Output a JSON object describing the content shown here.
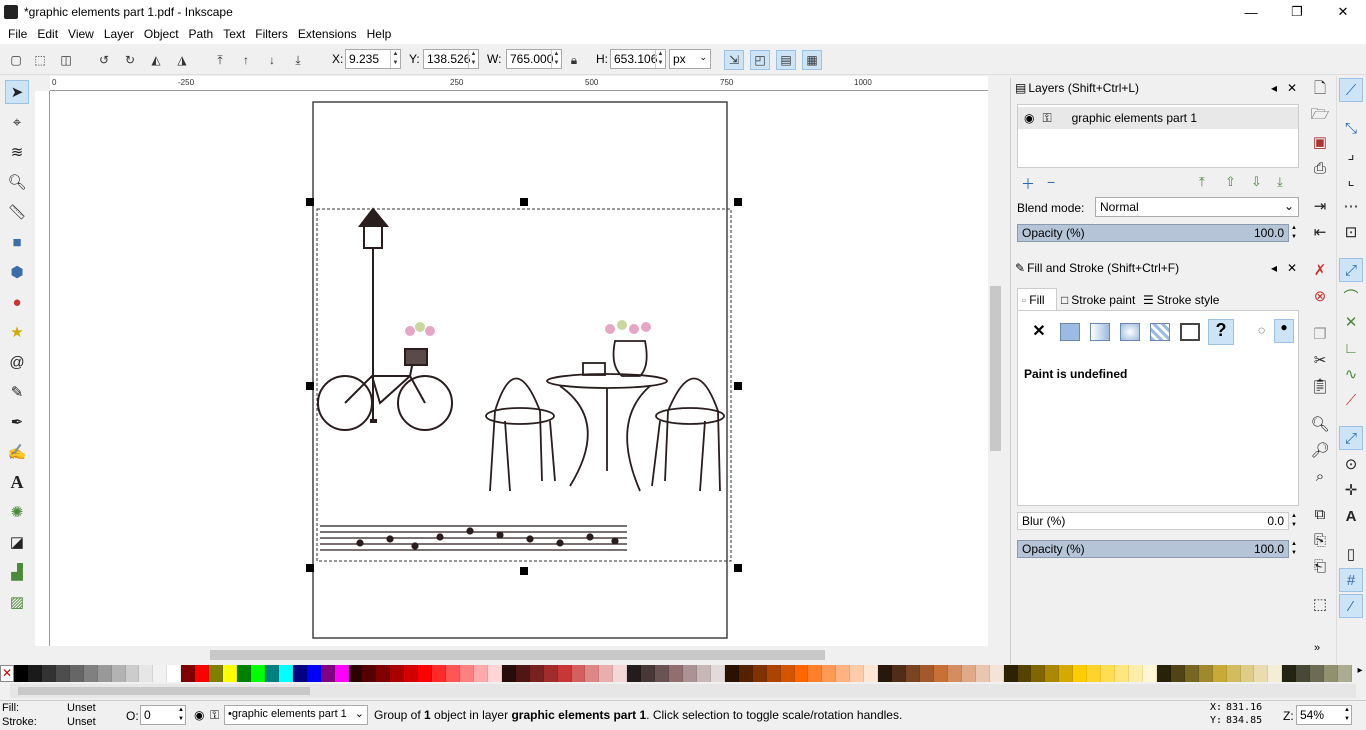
{
  "window": {
    "title": "*graphic elements part 1.pdf - Inkscape",
    "minimize": "—",
    "maximize": "❐",
    "close": "✕"
  },
  "menu": [
    "File",
    "Edit",
    "View",
    "Layer",
    "Object",
    "Path",
    "Text",
    "Filters",
    "Extensions",
    "Help"
  ],
  "toolcontrols": {
    "x_label": "X:",
    "x_value": "9.235",
    "y_label": "Y:",
    "y_value": "138.526",
    "w_label": "W:",
    "w_value": "765.000",
    "h_label": "H:",
    "h_value": "653.106",
    "unit": "px"
  },
  "ruler": {
    "labels": [
      "0",
      "-250",
      "250",
      "500",
      "750",
      "1000"
    ]
  },
  "layers_panel": {
    "title": "Layers (Shift+Ctrl+L)",
    "layer_name": "graphic elements part 1",
    "blend_label": "Blend mode:",
    "blend_value": "Normal",
    "opacity_label": "Opacity (%)",
    "opacity_value": "100.0"
  },
  "fill_stroke_panel": {
    "title": "Fill and Stroke (Shift+Ctrl+F)",
    "tab_fill": "Fill",
    "tab_stroke_paint": "Stroke paint",
    "tab_stroke_style": "Stroke style",
    "paint_status": "Paint is undefined",
    "blur_label": "Blur (%)",
    "blur_value": "0.0",
    "opacity_label": "Opacity (%)",
    "opacity_value": "100.0"
  },
  "status": {
    "fill_label": "Fill:",
    "fill_value": "Unset",
    "stroke_label": "Stroke:",
    "stroke_value": "Unset",
    "o_label": "O:",
    "o_value": "0",
    "layer_select": "•graphic elements part 1",
    "message_pre": "Group of ",
    "message_count": "1",
    "message_mid": " object in layer ",
    "message_layer": "graphic elements part 1",
    "message_post": ". Click selection to toggle scale/rotation handles.",
    "coord_x_label": "X:",
    "coord_x": "831.16",
    "coord_y_label": "Y:",
    "coord_y": "834.85",
    "zoom_label": "Z:",
    "zoom": "54%"
  },
  "palette_colors": [
    "#000000",
    "#1a1a1a",
    "#333333",
    "#4d4d4d",
    "#666666",
    "#808080",
    "#999999",
    "#b3b3b3",
    "#cccccc",
    "#e6e6e6",
    "#f2f2f2",
    "#ffffff",
    "#800000",
    "#ff0000",
    "#808000",
    "#ffff00",
    "#008000",
    "#00ff00",
    "#008080",
    "#00ffff",
    "#000080",
    "#0000ff",
    "#800080",
    "#ff00ff",
    "#2b0000",
    "#550000",
    "#800000",
    "#aa0000",
    "#d40000",
    "#ff0000",
    "#ff2a2a",
    "#ff5555",
    "#ff8080",
    "#ffaaaa",
    "#ffd5d5",
    "#280b0b",
    "#501616",
    "#782121",
    "#a02c2c",
    "#c83737",
    "#d35f5f",
    "#de8787",
    "#e9afaf",
    "#f4d7d7",
    "#241c1c",
    "#483737",
    "#6c5353",
    "#916f6f",
    "#ac9393",
    "#c8b7b7",
    "#e3dbdb",
    "#2b1100",
    "#552200",
    "#803300",
    "#aa4400",
    "#d45500",
    "#ff6600",
    "#ff7f2a",
    "#ff9955",
    "#ffb380",
    "#ffccaa",
    "#ffe6d5",
    "#28170b",
    "#502d16",
    "#784421",
    "#a05a2c",
    "#c87137",
    "#d38d5f",
    "#deaa87",
    "#e9c6af",
    "#f4e3d7",
    "#2b2200",
    "#554400",
    "#806600",
    "#aa8800",
    "#d4aa00",
    "#ffcc00",
    "#ffd42a",
    "#ffdd55",
    "#ffe680",
    "#ffeeaa",
    "#fff6d5",
    "#28220b",
    "#504416",
    "#786721",
    "#a0892c",
    "#c8ab37",
    "#d3bc5f",
    "#decd87",
    "#e9ddaf",
    "#f4eed7",
    "#242414",
    "#484838",
    "#6c6c54",
    "#91916f",
    "#acac93"
  ]
}
